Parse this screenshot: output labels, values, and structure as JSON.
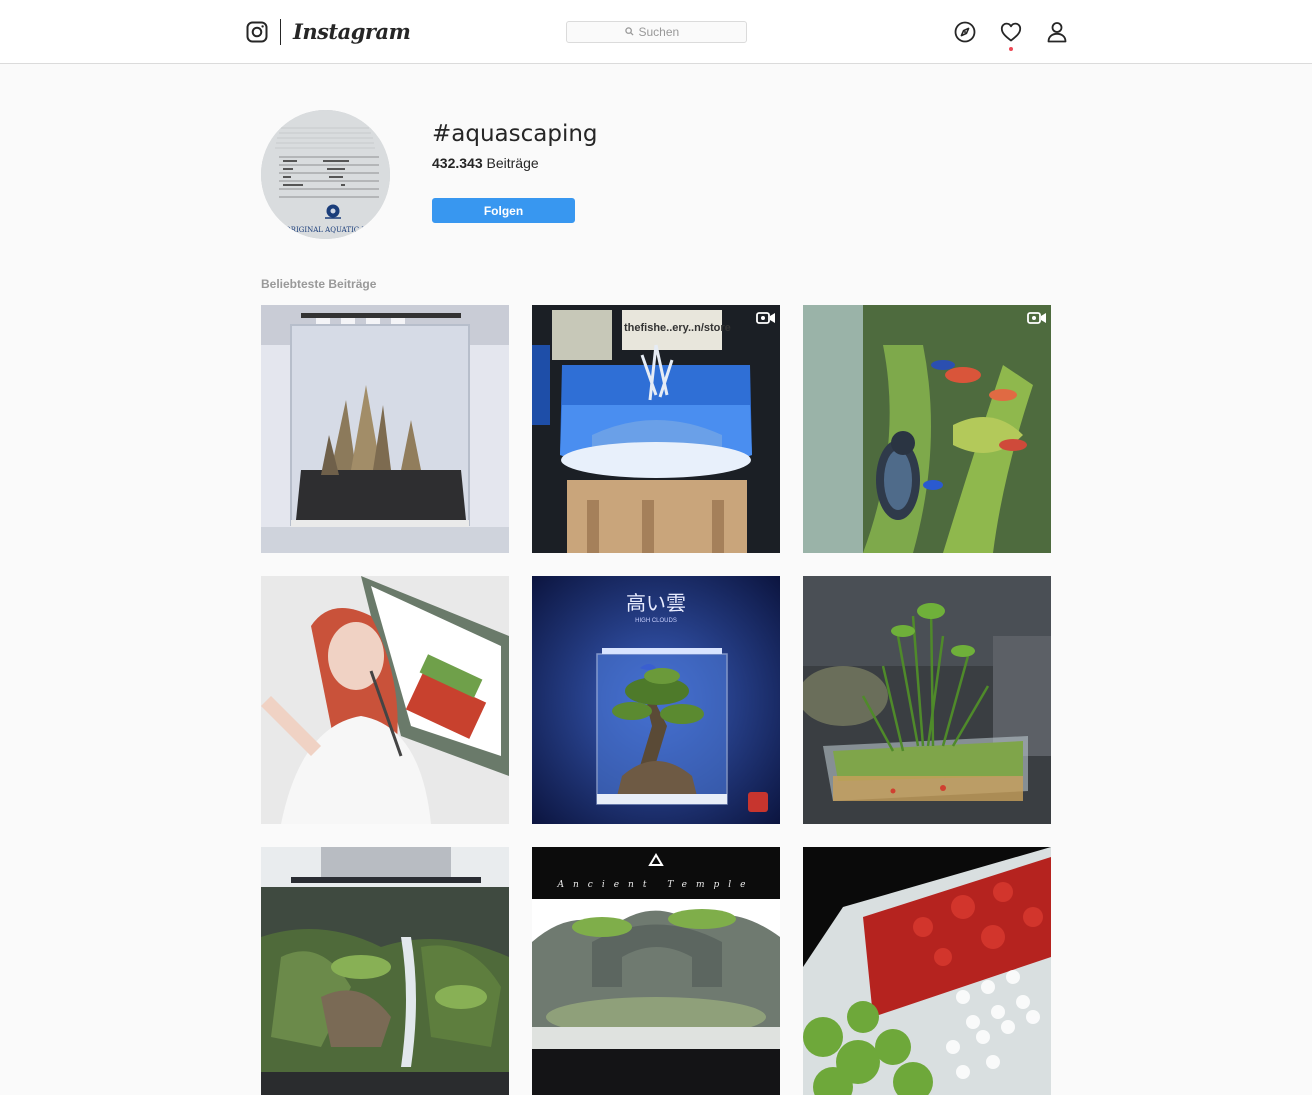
{
  "header": {
    "app_name": "Instagram",
    "search": {
      "placeholder": "Suchen"
    },
    "icons": [
      "instagram-camera-icon",
      "search-icon",
      "compass-icon",
      "heart-icon",
      "user-icon"
    ],
    "notification_dot_color": "#ed4956"
  },
  "profile": {
    "hashtag": "#aquascaping",
    "post_count": "432.343",
    "post_count_label": "Beiträge",
    "follow_label": "Folgen",
    "avatar_caption": "ORIGINAL AQUATIC PLANTS"
  },
  "grid": {
    "section_title": "Beliebteste Beiträge",
    "posts": [
      {
        "subject": "aquarium-rock-hardscape",
        "video": false
      },
      {
        "subject": "aquarium-shop-driftwood",
        "overlay_text": "thefishe..ery..n/store",
        "video": true
      },
      {
        "subject": "bird-fish-tank",
        "video": true
      },
      {
        "subject": "woman-selfie-aquarium",
        "video": false
      },
      {
        "subject": "bonsai-tree-tank",
        "overlay_title": "高い雲",
        "overlay_subtitle": "HIGH CLOUDS",
        "video": false
      },
      {
        "subject": "planted-nano-tank",
        "video": false
      },
      {
        "subject": "waterfall-aquascape",
        "video": false
      },
      {
        "subject": "ancient-temple-aquascape",
        "overlay_text": "Ancient Temple",
        "video": false
      },
      {
        "subject": "red-plants-light",
        "video": false
      }
    ]
  },
  "colors": {
    "accent": "#3897f0",
    "background": "#fafafa",
    "header_bg": "#ffffff",
    "muted_text": "#999999"
  }
}
